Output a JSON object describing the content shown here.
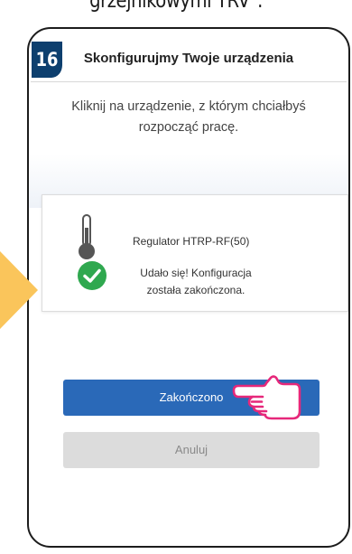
{
  "caption": "grzejnikowymi TRV\".",
  "step_number": "16",
  "screen": {
    "title": "Skonfigurujmy Twoje urządzenia",
    "instruction": "Kliknij na urządzenie, z którym chciałbyś rozpocząć pracę."
  },
  "device": {
    "name": "Regulator HTRP-RF(50)",
    "status_message": "Udało się! Konfiguracja została zakończona."
  },
  "buttons": {
    "finish_label": "Zakończono",
    "cancel_label": "Anuluj"
  },
  "colors": {
    "badge": "#0d3f6e",
    "arrow": "#fac55b",
    "primary_button": "#2a69b8",
    "success_check": "#2fa84f",
    "hand_outline": "#e6287a"
  },
  "icons": [
    "thermometer-icon",
    "checkmark-circle-icon",
    "pointing-hand-icon"
  ]
}
